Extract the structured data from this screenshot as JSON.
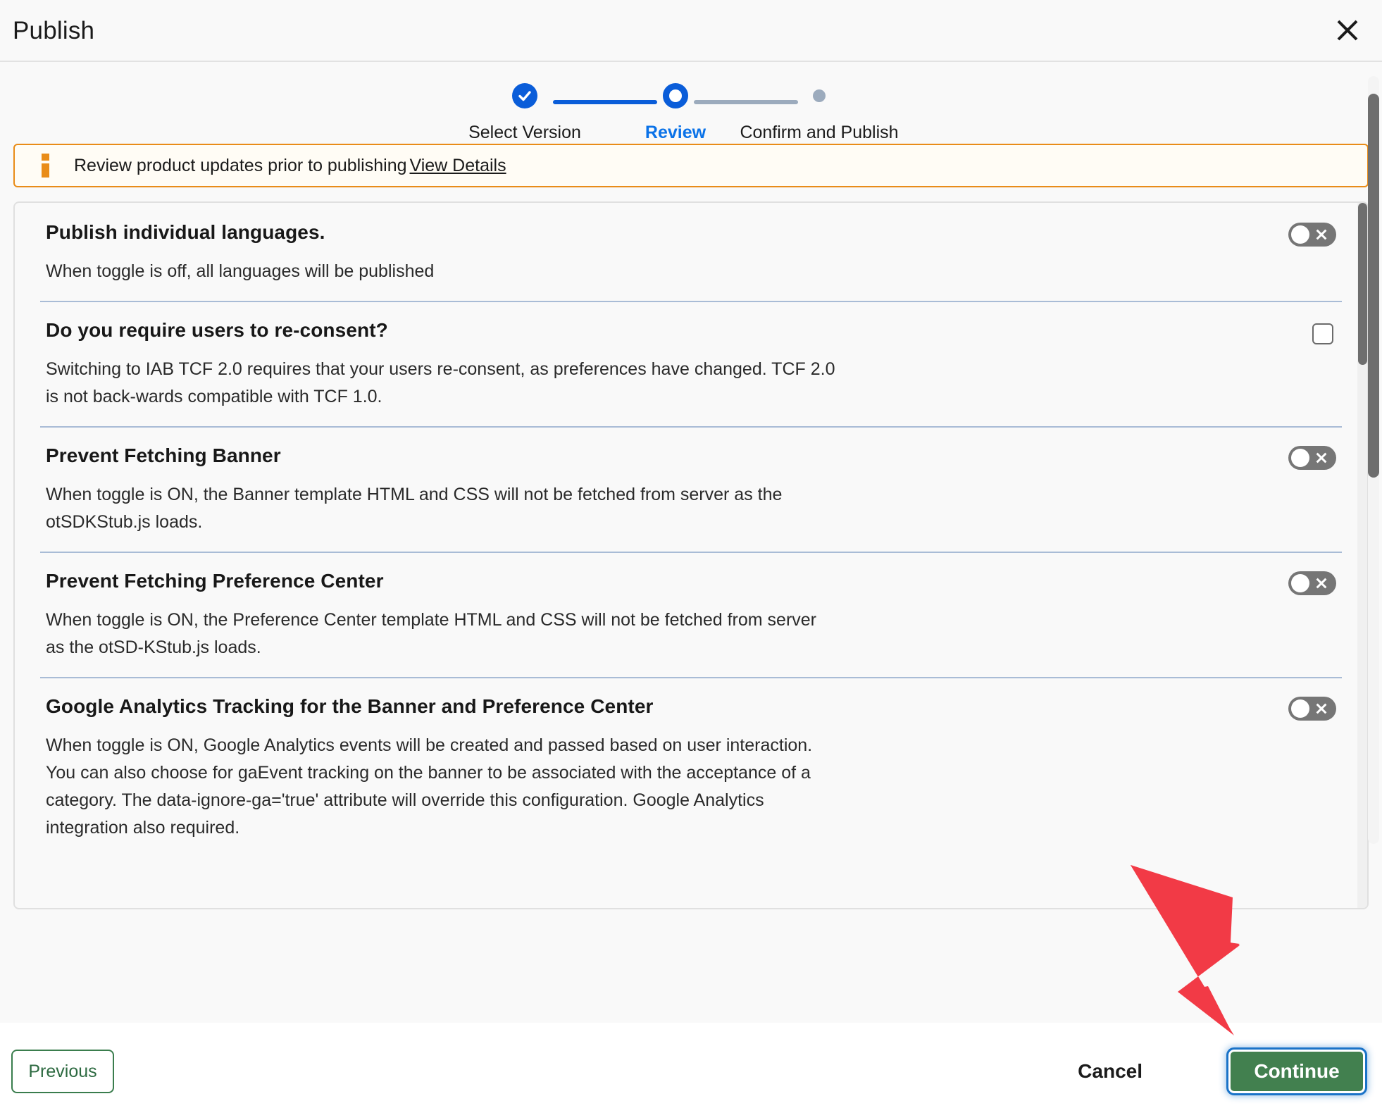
{
  "dialog": {
    "title": "Publish",
    "close_icon": "close-icon"
  },
  "stepper": {
    "steps": [
      {
        "label": "Select Version",
        "state": "complete"
      },
      {
        "label": "Review",
        "state": "current"
      },
      {
        "label": "Confirm and Publish",
        "state": "upcoming"
      }
    ],
    "accent_color": "#0a5dd9",
    "active_label_color": "#0a72e8",
    "inactive_color": "#9cabbd"
  },
  "info_banner": {
    "icon": "info-icon",
    "text": "Review product updates prior to publishing",
    "link_label": "View Details",
    "border_color": "#e98c18",
    "background_color": "#fffcf5"
  },
  "settings": [
    {
      "title": "Publish individual languages.",
      "description": "When toggle is off, all languages will be published",
      "control": "toggle",
      "control_state": "off"
    },
    {
      "title": "Do you require users to re-consent?",
      "description": "Switching to IAB TCF 2.0 requires that your users re-consent, as preferences have changed. TCF 2.0 is not back-wards compatible with TCF 1.0.",
      "control": "checkbox",
      "control_state": "unchecked"
    },
    {
      "title": "Prevent Fetching Banner",
      "description": "When toggle is ON, the Banner template HTML and CSS will not be fetched from server as the otSDKStub.js loads.",
      "control": "toggle",
      "control_state": "off"
    },
    {
      "title": "Prevent Fetching Preference Center",
      "description": "When toggle is ON, the Preference Center template HTML and CSS will not be fetched from server as the otSD-KStub.js loads.",
      "control": "toggle",
      "control_state": "off"
    },
    {
      "title": "Google Analytics Tracking for the Banner and Preference Center",
      "description": "When toggle is ON, Google Analytics events will be created and passed based on user interaction. You can also choose for gaEvent tracking on the banner to be associated with the acceptance of a category. The data-ignore-ga='true' attribute will override this configuration. Google Analytics integration also required.",
      "control": "toggle",
      "control_state": "off"
    }
  ],
  "footer": {
    "previous_label": "Previous",
    "cancel_label": "Cancel",
    "continue_label": "Continue",
    "continue_color": "#42804f",
    "previous_border_color": "#3a7d4d",
    "focus_ring_color": "#1a73c8"
  },
  "annotation": {
    "type": "arrow",
    "color": "#f23a46",
    "points_to": "Continue"
  }
}
